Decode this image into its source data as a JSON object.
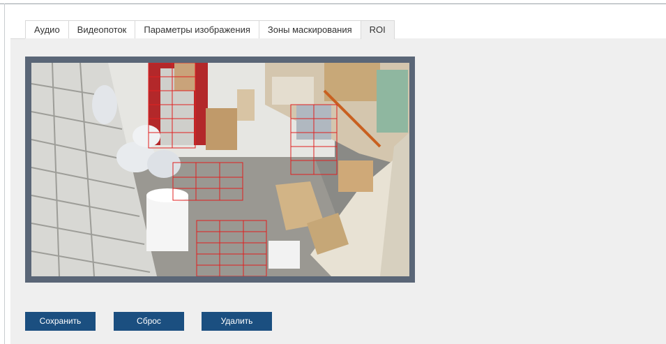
{
  "tabs": [
    {
      "label": "Аудио",
      "active": false
    },
    {
      "label": "Видеопоток",
      "active": false
    },
    {
      "label": "Параметры изображения",
      "active": false
    },
    {
      "label": "Зоны маскирования",
      "active": false
    },
    {
      "label": "ROI",
      "active": true
    }
  ],
  "buttons": {
    "save": "Сохранить",
    "reset": "Сброс",
    "delete": "Удалить"
  },
  "colors": {
    "accent_button": "#1b4f80",
    "roi_grid": "#e02020",
    "video_border": "#5a6677",
    "panel_bg": "#efefef"
  }
}
